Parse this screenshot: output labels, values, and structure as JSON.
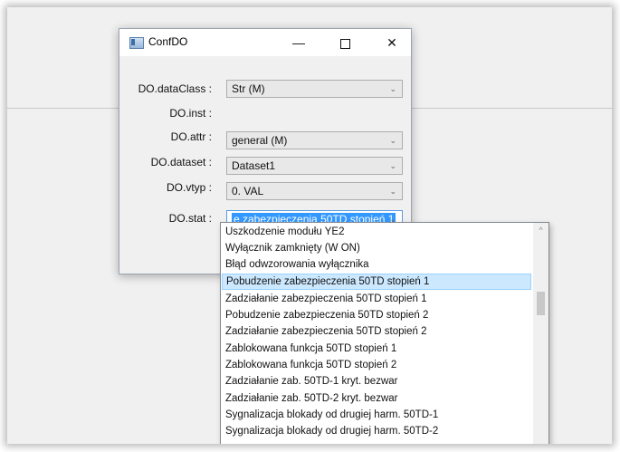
{
  "window": {
    "title": "ConfDO",
    "minimize": "—",
    "close": "✕"
  },
  "form": {
    "fields": [
      {
        "label": "DO.dataClass :",
        "value": "Str (M)"
      },
      {
        "label": "DO.inst :",
        "value": ""
      },
      {
        "label": "DO.attr :",
        "value": "general (M)"
      },
      {
        "label": "DO.dataset :",
        "value": "Dataset1"
      },
      {
        "label": "DO.vtyp :",
        "value": "0. VAL"
      },
      {
        "label": "DO.stat :",
        "value": "e zabezpieczenia 50TD stopień 1"
      }
    ],
    "chevron": "⌄"
  },
  "dropdown": {
    "items": [
      "Uszkodzenie modułu YE2",
      "Wyłącznik zamknięty (W ON)",
      "Błąd odwzorowania wyłącznika",
      "Pobudzenie zabezpieczenia 50TD stopień 1",
      "Zadziałanie zabezpieczenia 50TD stopień 1",
      "Pobudzenie zabezpieczenia 50TD stopień 2",
      "Zadziałanie zabezpieczenia 50TD stopień 2",
      "Zablokowana funkcja 50TD stopień 1",
      "Zablokowana funkcja 50TD stopień 2",
      "Zadziałanie zab. 50TD-1  kryt. bezwar",
      "Zadziałanie zab. 50TD-2  kryt. bezwar",
      "Sygnalizacja blokady od drugiej harm. 50TD-1",
      "Sygnalizacja blokady od drugiej harm. 50TD-2"
    ],
    "highlighted_index": 3,
    "scroll_up": "^"
  }
}
